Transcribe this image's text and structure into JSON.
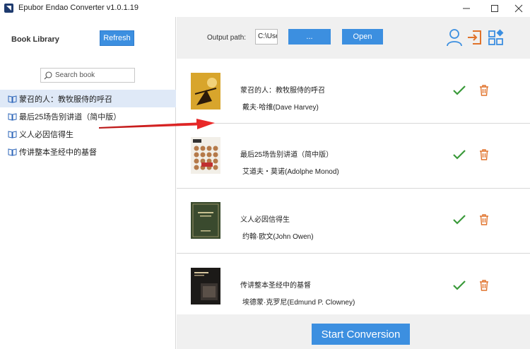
{
  "window": {
    "title": "Epubor Endao Converter v1.0.1.19"
  },
  "left_panel": {
    "library_label": "Book Library",
    "refresh_label": "Refresh",
    "search_placeholder": "Search book",
    "items": [
      {
        "label": "蒙召的人：教牧服侍的呼召",
        "selected": true
      },
      {
        "label": "最后25场告别讲道（简中版）",
        "selected": false
      },
      {
        "label": "义人必因信得生",
        "selected": false
      },
      {
        "label": "传讲整本圣经中的基督",
        "selected": false
      }
    ]
  },
  "toolbar": {
    "output_label": "Output path:",
    "output_path": "C:\\Use",
    "browse_label": "...",
    "open_label": "Open"
  },
  "books": [
    {
      "title": "蒙召的人：教牧服侍的呼召",
      "author": "戴夫·哈维(Dave Harvey)",
      "cover_bg": "#d8a52c"
    },
    {
      "title": "最后25场告别讲道（简中版）",
      "author": "艾道夫・莫诺(Adolphe Monod)",
      "cover_bg": "#f2efe8"
    },
    {
      "title": "义人必因信得生",
      "author": "约翰·欧文(John Owen)",
      "cover_bg": "#3a4a2e"
    },
    {
      "title": "传讲整本圣经中的基督",
      "author": "埃德蒙·克罗尼(Edmund P. Clowney)",
      "cover_bg": "#1c1a18"
    }
  ],
  "actions": {
    "start_label": "Start Conversion"
  },
  "colors": {
    "accent": "#3c8fe0",
    "check": "#3a9a3a",
    "trash": "#e0722a",
    "arrow": "#e02020"
  }
}
